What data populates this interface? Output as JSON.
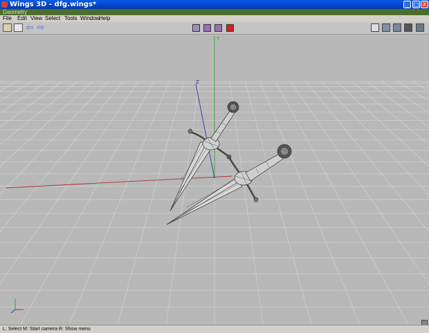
{
  "window": {
    "title": "Wings 3D - dfg.wings*",
    "minimize": "_",
    "maximize": "□",
    "close": "X"
  },
  "geometry_bar": {
    "label": "Geometry"
  },
  "menu": [
    "File",
    "Edit",
    "View",
    "Select",
    "Tools",
    "Window",
    "Help"
  ],
  "toolbar": {
    "undo_icon": "arrow-left-icon",
    "redo_icon": "arrow-right-icon",
    "selection_modes": [
      "vertex",
      "edge",
      "face",
      "body"
    ],
    "selection_colors": [
      "#9a90c0",
      "#9a70b8",
      "#9a70b0",
      "#d02020"
    ],
    "right_icons": [
      "orthographic-icon",
      "smooth-shading-icon",
      "wireframe-icon",
      "axis-grid-icon"
    ]
  },
  "axes": {
    "y_label": "Y",
    "z_label": "Z",
    "x_color": "#b03030",
    "y_color": "#20b020",
    "z_color": "#3030b0"
  },
  "status": {
    "text": "L: Select   M: Start camera   R: Show menu"
  }
}
